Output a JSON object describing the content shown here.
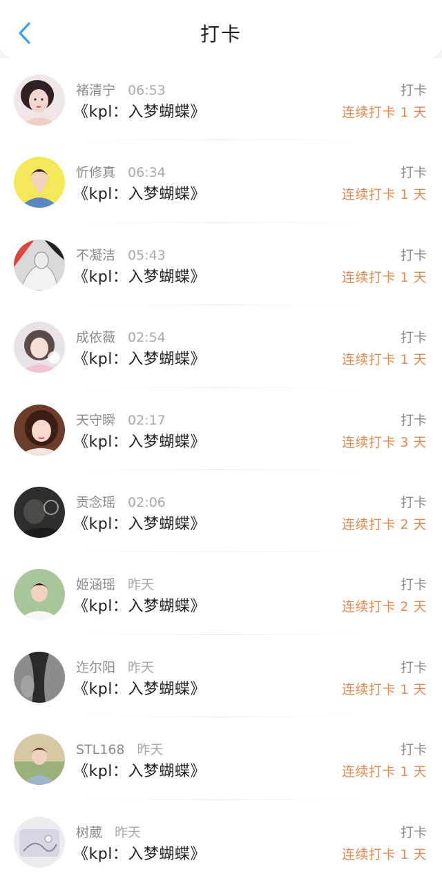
{
  "header": {
    "title": "打卡",
    "back_icon": "chevron-left-icon",
    "accent_color": "#3aa0e8"
  },
  "colors": {
    "streak": "#e48a4f",
    "muted": "#8a8a8a",
    "text": "#222222"
  },
  "items": [
    {
      "name": "褚清宁",
      "time": "06:53",
      "book": "《kpl：入梦蝴蝶》",
      "action": "打卡",
      "streak": "连续打卡 1 天"
    },
    {
      "name": "忻修真",
      "time": "06:34",
      "book": "《kpl：入梦蝴蝶》",
      "action": "打卡",
      "streak": "连续打卡 1 天"
    },
    {
      "name": "不凝洁",
      "time": "05:43",
      "book": "《kpl：入梦蝴蝶》",
      "action": "打卡",
      "streak": "连续打卡 1 天"
    },
    {
      "name": "成依薇",
      "time": "02:54",
      "book": "《kpl：入梦蝴蝶》",
      "action": "打卡",
      "streak": "连续打卡 1 天"
    },
    {
      "name": "天守瞬",
      "time": "02:17",
      "book": "《kpl：入梦蝴蝶》",
      "action": "打卡",
      "streak": "连续打卡 3 天"
    },
    {
      "name": "贡念瑶",
      "time": "02:06",
      "book": "《kpl：入梦蝴蝶》",
      "action": "打卡",
      "streak": "连续打卡 2 天"
    },
    {
      "name": "姬涵瑶",
      "time": "昨天",
      "book": "《kpl：入梦蝴蝶》",
      "action": "打卡",
      "streak": "连续打卡 2 天"
    },
    {
      "name": "迮尔阳",
      "time": "昨天",
      "book": "《kpl：入梦蝴蝶》",
      "action": "打卡",
      "streak": "连续打卡 1 天"
    },
    {
      "name": "STL168",
      "time": "昨天",
      "book": "《kpl：入梦蝴蝶》",
      "action": "打卡",
      "streak": "连续打卡 1 天"
    },
    {
      "name": "树葳",
      "time": "昨天",
      "book": "《kpl：入梦蝴蝶》",
      "action": "打卡",
      "streak": "连续打卡 1 天"
    }
  ]
}
